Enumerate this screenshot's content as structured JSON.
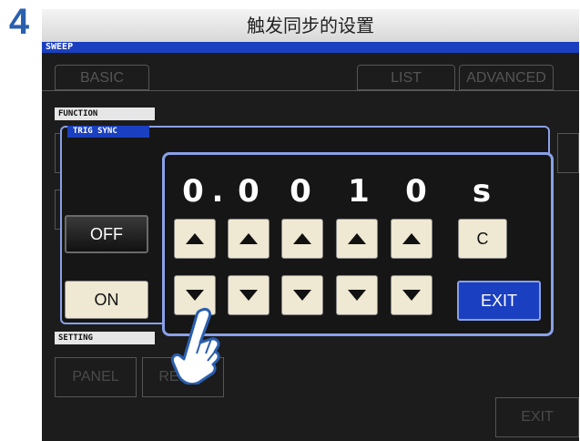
{
  "step_number": "4",
  "header_title": "触发同步的设置",
  "screen": {
    "mode_label": "SWEEP",
    "tabs": [
      {
        "label": "BASIC"
      },
      {
        "label": "LIST"
      },
      {
        "label": "ADVANCED"
      }
    ],
    "function_label": "FUNCTION",
    "setting_label": "SETTING",
    "bottom_buttons": {
      "panel": "PANEL",
      "reset": "RESET",
      "exit": "EXIT"
    }
  },
  "dialog": {
    "title": "TRIG SYNC",
    "off_label": "OFF",
    "on_label": "ON",
    "value_digits": [
      "0",
      ".",
      "0",
      "0",
      "1",
      "0"
    ],
    "unit": "s",
    "clear_label": "C",
    "exit_label": "EXIT"
  },
  "colors": {
    "accent_blue": "#1a3fc0",
    "highlight_border": "#8aa0e8",
    "key_face": "#efe8d2",
    "step_number": "#2b5fae"
  },
  "icons": {
    "pointer": "pointing-hand-icon",
    "up": "up-triangle-icon",
    "down": "down-triangle-icon"
  }
}
